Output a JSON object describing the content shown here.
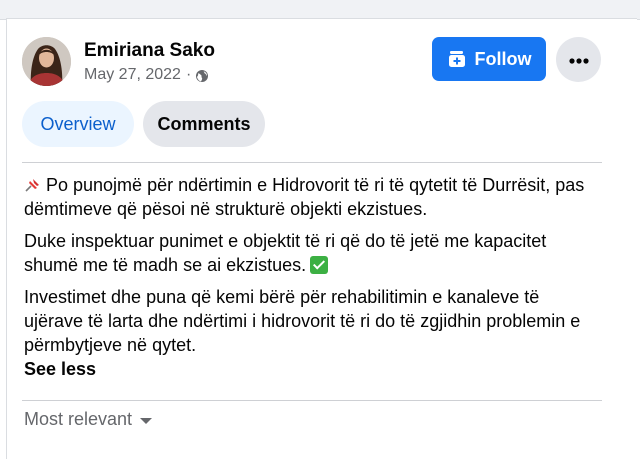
{
  "author": {
    "name": "Emiriana Sako",
    "date": "May 27, 2022",
    "separator": "·",
    "privacy_icon": "globe-icon"
  },
  "actions": {
    "follow_label": "Follow",
    "follow_icon": "add-page-icon",
    "more_icon": "ellipsis-icon"
  },
  "tabs": [
    {
      "label": "Overview",
      "active": true
    },
    {
      "label": "Comments",
      "active": false
    }
  ],
  "post": {
    "paragraph1": "Po punojmë për ndërtimin e Hidrovorit të ri të qytetit të Durrësit, pas dëmtimeve që pësoi në strukturë objekti ekzistues.",
    "paragraph2": "Duke inspektuar punimet e objektit të ri që do të jetë me kapacitet shumë me të madh se ai ekzistues.",
    "paragraph3": "Investimet dhe puna që kemi bërë për rehabilitimin e kanaleve të ujërave të larta dhe ndërtimi i hidrovorit të ri do të zgjidhin problemin e përmbytjeve në qytet.",
    "see_less": "See less",
    "emoji_pin": "pushpin-icon",
    "emoji_check": "check-mark-icon"
  },
  "comments": {
    "sort_label": "Most relevant",
    "sort_icon": "caret-down-icon"
  },
  "colors": {
    "accent": "#1877f2",
    "tab_active_bg": "#ebf5ff",
    "tab_active_text": "#0b5fcc",
    "secondary_text": "#65676b"
  }
}
